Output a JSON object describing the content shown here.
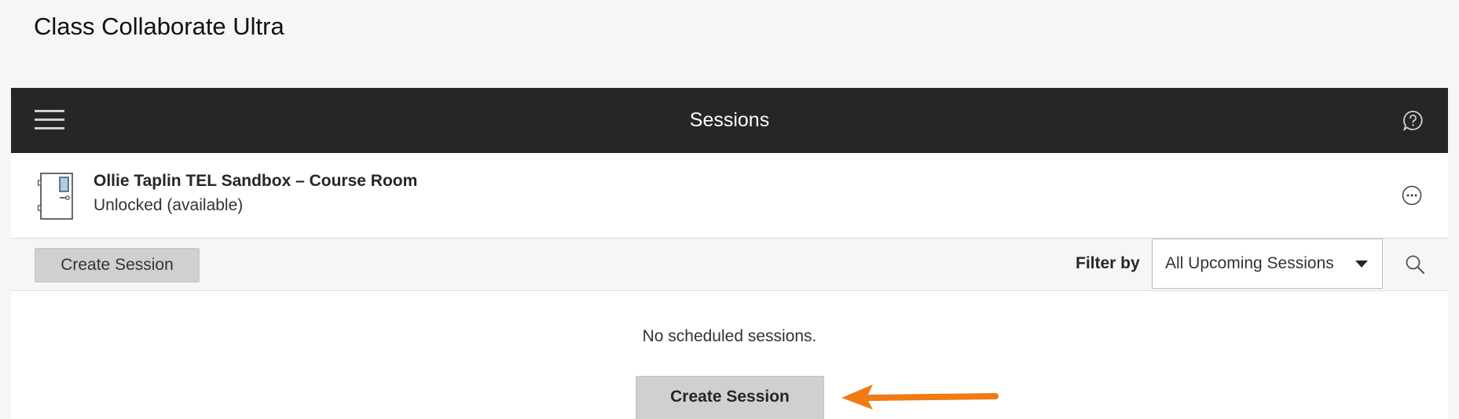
{
  "page": {
    "title": "Class Collaborate Ultra"
  },
  "topbar": {
    "title": "Sessions",
    "menu_icon": "hamburger-menu-icon",
    "help_icon": "help-icon"
  },
  "room": {
    "name": "Ollie Taplin TEL Sandbox – Course Room",
    "status": "Unlocked (available)",
    "icon": "door-icon",
    "more_icon": "more-options-icon"
  },
  "toolbar": {
    "create_label": "Create Session",
    "filter_label": "Filter by",
    "filter_value": "All Upcoming Sessions",
    "search_icon": "search-icon"
  },
  "main": {
    "empty_message": "No scheduled sessions.",
    "create_label": "Create Session"
  },
  "annotation": {
    "arrow_color": "#f07b15"
  },
  "colors": {
    "topbar_bg": "#262626",
    "button_bg": "#d0d0d0",
    "page_bg": "#f6f6f6"
  }
}
